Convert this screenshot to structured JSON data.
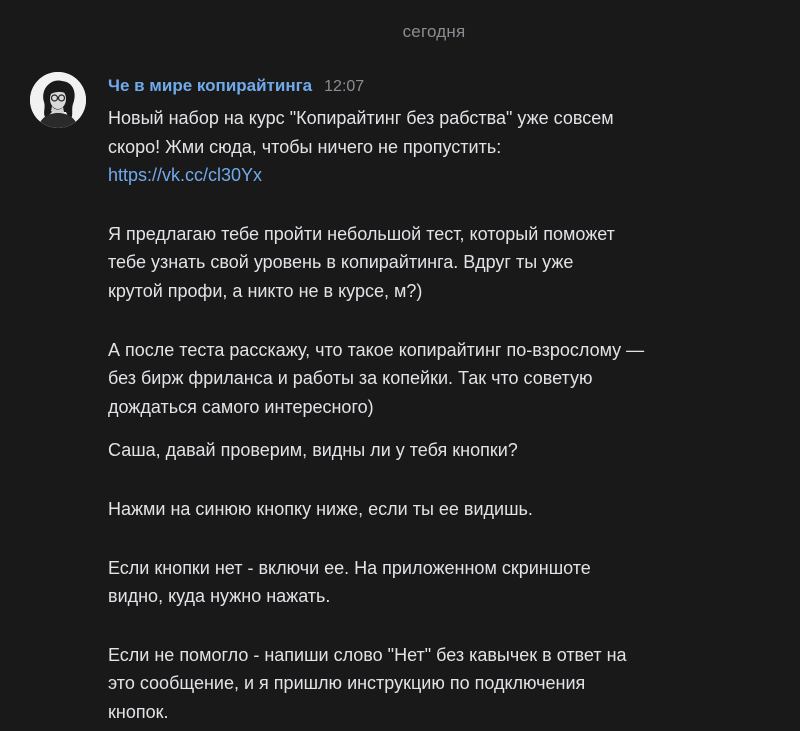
{
  "date_divider": "сегодня",
  "message": {
    "author": "Че в мире копирайтинга",
    "time": "12:07",
    "avatar_icon": "author-portrait",
    "paragraphs": [
      {
        "lines": [
          "Новый набор на курс \"Копирайтинг без рабства\" уже совсем",
          "скоро! Жми сюда, чтобы ничего не пропустить:"
        ],
        "link": "https://vk.cc/cl30Yx"
      },
      {
        "lines": [
          "Я предлагаю тебе пройти небольшой тест, который поможет",
          "тебе узнать свой уровень в копирайтинга. Вдруг ты уже",
          "крутой профи, а никто не в курсе, м?)"
        ]
      },
      {
        "lines": [
          "А после теста расскажу, что такое копирайтинг по-взрослому —",
          "без бирж фриланса и работы за копейки. Так что советую",
          "дождаться самого интересного)"
        ]
      },
      {
        "lines": [
          "Саша, давай проверим, видны ли у тебя кнопки?"
        ]
      },
      {
        "lines": [
          "Нажми на синюю кнопку ниже, если ты ее видишь."
        ]
      },
      {
        "lines": [
          "Если кнопки нет - включи ее. На приложенном скриншоте",
          "видно, куда нужно нажать."
        ]
      },
      {
        "lines": [
          "Если не помогло - напиши слово \"Нет\" без кавычек в ответ на",
          "это сообщение, и я пришлю инструкцию по подключения",
          "кнопок."
        ]
      }
    ]
  },
  "colors": {
    "background": "#19191a",
    "text": "#e1e3e6",
    "secondary": "#8a8d91",
    "accent": "#71aaeb"
  }
}
